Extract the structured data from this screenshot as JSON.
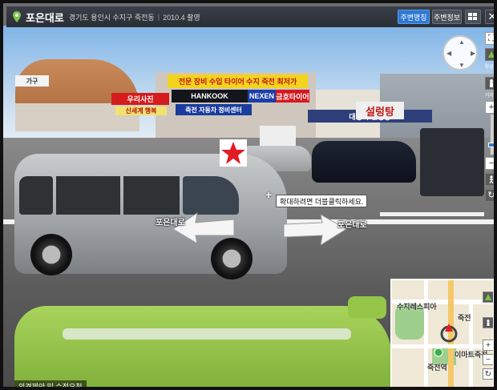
{
  "topbar": {
    "road_name": "포은대로",
    "address": "경기도 용인시 수지구 죽전동",
    "date_taken": "2010.4 촬영",
    "nearby_button": "주변명칭",
    "info_button": "주변정보",
    "close_glyph": "✕"
  },
  "signs": {
    "yellow_banner": "전문 장비 수입 타이어 수지 죽전 최저가",
    "hankook": "HANKOOK",
    "nexen": "NEXEN",
    "kumho": "금호타이어",
    "blue_center": "죽전 자동차 정비센터",
    "red_shop": "우리사진",
    "red_shop_sub": "신세계 행복",
    "market": "대정국 설렁탕",
    "market_big": "설렁탕",
    "left_white": "가구"
  },
  "scene": {
    "road_label_left": "포은대로",
    "road_label_right": "포은대로",
    "tooltip": "확대하려면 더블클릭하세요.",
    "crosshair": "+"
  },
  "controls": {
    "walk_label": "항공뷰",
    "road_label": "거리뷰",
    "zoom_in": "+",
    "zoom_out": "−",
    "zoom_level": 0.25,
    "fullscreen": "⛶",
    "refresh": "↻"
  },
  "minimap": {
    "labels": [
      "수지레스피아",
      "죽전",
      "이마트죽전",
      "죽전역"
    ],
    "zoom_in": "+",
    "zoom_out": "−",
    "view_label": "항공뷰",
    "street_label": "거리뷰"
  },
  "footer": {
    "feedback": "의견제안 및 수정요청"
  },
  "colors": {
    "accent_blue": "#2f79d3",
    "topbar_bg": "#2e323a",
    "star_red": "#e31b23"
  }
}
